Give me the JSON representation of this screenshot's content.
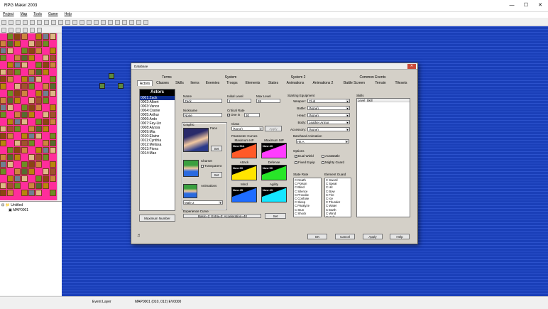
{
  "app": {
    "title": "RPG Maker 2003",
    "menu": [
      "Project",
      "Map",
      "Tools",
      "Game",
      "Help"
    ]
  },
  "window_buttons": [
    "—",
    "☐",
    "✕"
  ],
  "tree": {
    "root": "Untitled",
    "child": "MAP0001"
  },
  "status": {
    "layer": "Event Layer",
    "position": "MAP0001 (010, 012) EV0000"
  },
  "dialog": {
    "title": "Database",
    "tabs_top": [
      "Terms",
      "System",
      "System 2",
      "Common Events"
    ],
    "tabs_bottom": [
      "Actors",
      "Classes",
      "Skills",
      "Items",
      "Enemies",
      "Troops",
      "Elements",
      "States",
      "Animations",
      "Animations 2",
      "Battle Screen",
      "Terrain",
      "Tilesets"
    ],
    "actors_header": "Actors",
    "actors": [
      "0001:Zack",
      "0002:Albert",
      "0003:Vance",
      "0004:Cranie",
      "0005:Arthur",
      "0006:Ardo",
      "0007:Fey-Lin",
      "0008:Alyssa",
      "0009:Mia",
      "0010:Elaine",
      "0011:Cynthia",
      "0012:Melissa",
      "0013:Fiona",
      "0014:Mao"
    ],
    "max_number_btn": "Maximum Number",
    "name_label": "Name",
    "name_value": "Zack",
    "initial_level_label": "Initial Level",
    "initial_level": "1",
    "max_level_label": "Max Level",
    "max_level": "99",
    "nickname_label": "Nickname",
    "nickname_value": "None",
    "critical_label": "Critical Rate",
    "critical_one_in": "One in",
    "critical_value": "30",
    "apply_small": "Apply",
    "graphic_label": "Graphic",
    "face_label": "Face",
    "set": "Set",
    "charset_label": "Charset",
    "transparent": "Transparent",
    "animations_label": "Animations",
    "animation_value": "Male 2",
    "class_label": "Class",
    "class_value": "(None)",
    "param_label": "Parameter Curves",
    "curves": [
      {
        "title": "Maximum HP",
        "now": "Now 514",
        "color": "#ff5a28"
      },
      {
        "title": "Maximum MP",
        "now": "Now 43",
        "color": "#ff3cff"
      },
      {
        "title": "Attack",
        "now": "Now 69",
        "color": "#ffe400"
      },
      {
        "title": "Defense",
        "now": "Now 59",
        "color": "#28e628"
      },
      {
        "title": "Mind",
        "now": "Now 45",
        "color": "#1e6cff"
      },
      {
        "title": "Agility",
        "now": "Now 43",
        "color": "#14e6ff"
      }
    ],
    "exp_label": "Experience Curve",
    "exp_value": "Basic=1; Extra=0; Acceleration=40",
    "equip_label": "Starting Equipment",
    "equip": [
      {
        "slot": "Weapon:",
        "value": "Club"
      },
      {
        "slot": "Battle:",
        "value": "(None)"
      },
      {
        "slot": "Head:",
        "value": "(None)"
      },
      {
        "slot": "Body:",
        "value": "Leather Armor"
      },
      {
        "slot": "Accessory:",
        "value": "(None)"
      }
    ],
    "barehand_label": "Barehand Animation",
    "barehand_value": "Hit A",
    "options_label": "Options",
    "options": [
      {
        "label": "Dual Wield",
        "checked": true
      },
      {
        "label": "AutoBattle",
        "checked": false
      },
      {
        "label": "Fixed Equip",
        "checked": false
      },
      {
        "label": "Mighty Guard",
        "checked": false
      }
    ],
    "state_label": "State Rate",
    "states": [
      "C Death",
      "C Poison",
      "C Blind",
      "C Silence",
      "C Provoke",
      "C Confuse",
      "C Sleep",
      "C Paralyze",
      "C Stun",
      "C Shock"
    ],
    "element_label": "Element Guard",
    "elements": [
      "C Sword",
      "C Spear",
      "C Hit",
      "C Bow",
      "C Fire",
      "C Ice",
      "C Thunder",
      "C Water",
      "C Earth",
      "C Wind",
      "C Holy"
    ],
    "skills_label": "Skills",
    "skills_cols": [
      "Level",
      "Skill"
    ],
    "buttons": {
      "ok": "OK",
      "cancel": "Cancel",
      "apply": "Apply",
      "help": "Help"
    }
  }
}
